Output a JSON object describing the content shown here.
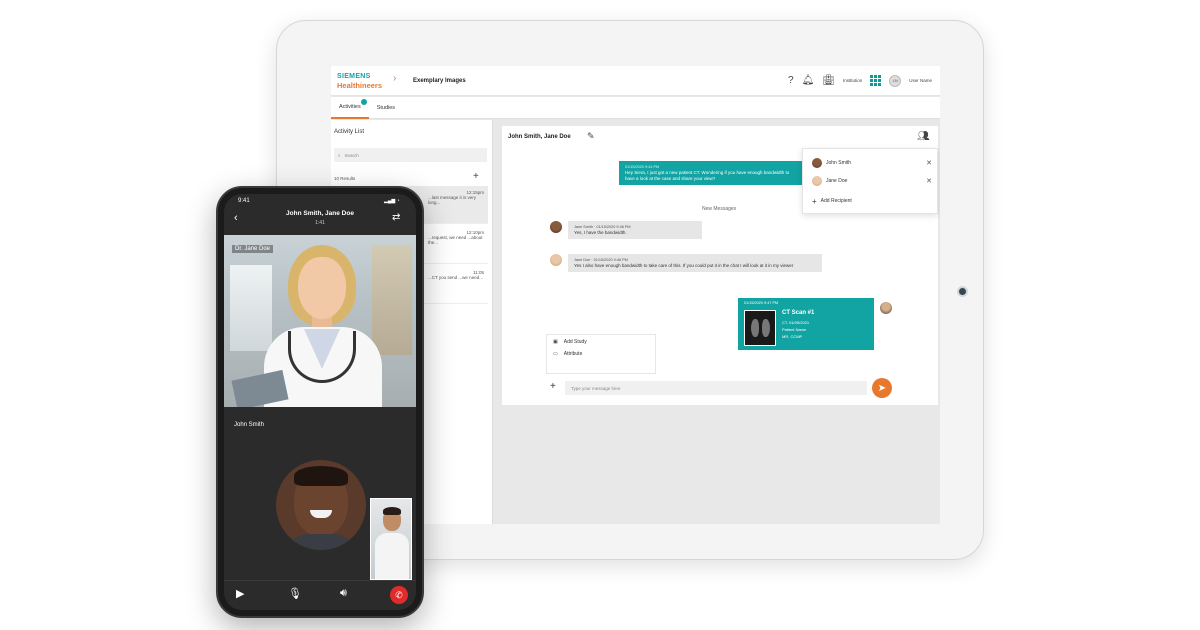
{
  "tablet": {
    "logo": {
      "line1": "SIEMENS",
      "line2": "Healthineers"
    },
    "app_title": "Exemplary Images",
    "header": {
      "help": "?",
      "org": "Institution",
      "user_initials": "LN",
      "user_name": "User Name"
    },
    "tabs": [
      "Activities",
      "Studies"
    ],
    "left_panel": {
      "title": "Activity List",
      "search_placeholder": "Search",
      "results": "10 Results",
      "items": [
        {
          "time": "12:15pm",
          "text": "...last message it is very long..."
        },
        {
          "time": "12:10pm",
          "text": "...request, we need ...about the..."
        },
        {
          "time": "11:05",
          "text": "...CT you send ...we need..."
        }
      ]
    },
    "chat": {
      "header": "John Smith, Jane Doe",
      "outgoing_meta": "01/15/2020 9:44 PM",
      "outgoing_text": "Hey Siera, I just got a new patient CT. Wondering if you have enough bandwidth to have a look at the case and share your view?",
      "new_messages": "New Messages",
      "msg1": {
        "meta": "Jane Smith · 01/15/2020 9:46 PM",
        "text": "Yes, I have the bandwidth."
      },
      "msg2": {
        "meta": "Jane Doe · 01/15/2020 9:46 PM",
        "text": "Yes I also have enough bandwidth to take care of this. If you could put it in the chat I will look at it in my viewer"
      },
      "ct_card": {
        "meta": "01/15/2020 9:47 PM",
        "title": "CT Scan #1",
        "l1": "CT, 01/05/2021",
        "l2": "Patient Name",
        "l3": "MR, CCMP"
      },
      "add_menu": [
        "Add Study",
        "Attribute"
      ],
      "input_placeholder": "Type your message here",
      "participants": [
        {
          "name": "John Smith"
        },
        {
          "name": "Jane Doe"
        }
      ],
      "add_participant": "Add Recipient"
    }
  },
  "phone": {
    "status_time": "9:41",
    "status_right": "▂▄▆ ◔",
    "call_title": "John Smith, Jane Doe",
    "call_time": "1:41",
    "main_caller": "Dr. Jane Doe",
    "second_caller": "John Smith"
  },
  "colors": {
    "teal": "#12a3a3",
    "orange": "#e8782d",
    "hangup": "#e02b2b"
  }
}
